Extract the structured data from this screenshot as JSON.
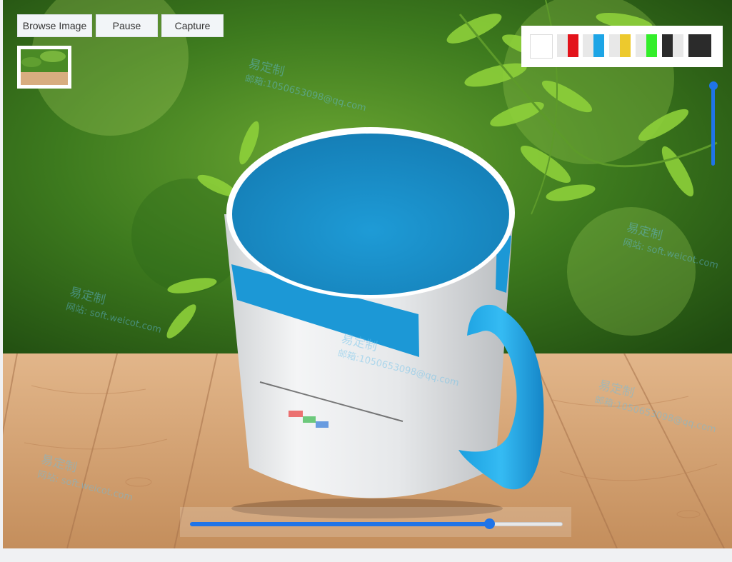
{
  "toolbar": {
    "browse_label": "Browse Image",
    "pause_label": "Pause",
    "capture_label": "Capture"
  },
  "palette": {
    "swatches": [
      {
        "name": "white",
        "left": "#ffffff",
        "right": "#ffffff"
      },
      {
        "name": "red",
        "left": "#e8e8e8",
        "right": "#e3131b"
      },
      {
        "name": "blue",
        "left": "#e8e8e8",
        "right": "#1da5e6"
      },
      {
        "name": "yellow",
        "left": "#e8e8e8",
        "right": "#edc92d"
      },
      {
        "name": "green",
        "left": "#e8e8e8",
        "right": "#33ee2a"
      },
      {
        "name": "black-white",
        "left": "#2b2b2b",
        "right": "#e8e8e8"
      },
      {
        "name": "black",
        "left": "#2b2b2b",
        "right": "#2b2b2b"
      }
    ]
  },
  "rotation_slider": {
    "value": 0.81
  },
  "zoom_slider": {
    "value": 0.97
  },
  "colors": {
    "accent": "#1f74e8",
    "mug_inner": "#1a96d2",
    "handle": "#2db0ea"
  },
  "watermark": {
    "brand": "易定制",
    "site": "网站: soft.weicot.com",
    "mail": "邮箱:1050653098@qq.com"
  }
}
